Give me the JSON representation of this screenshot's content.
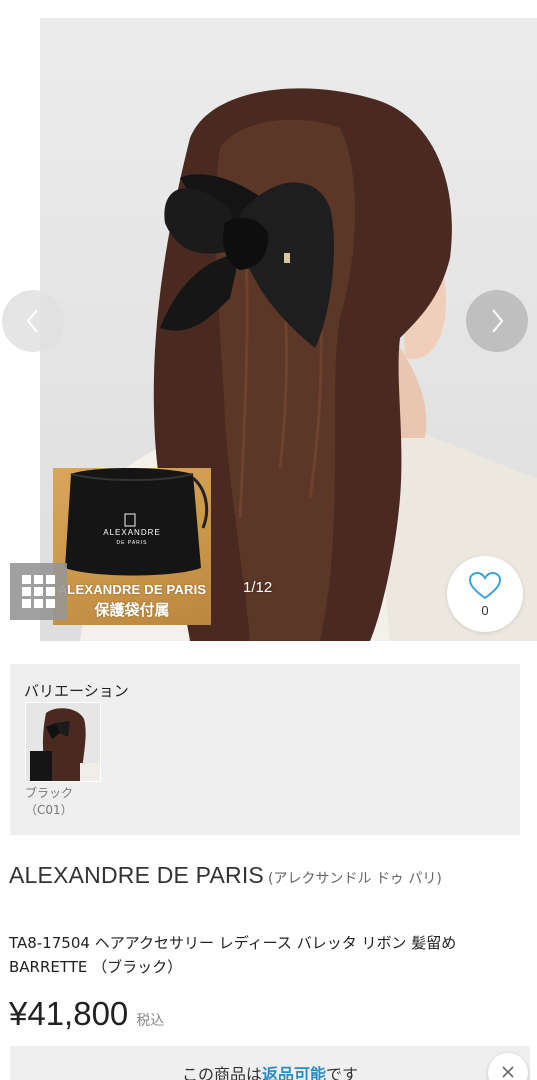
{
  "gallery": {
    "counter": "1/12",
    "promo": {
      "brand": "ALEXANDRE DE PARIS",
      "subtitle": "保護袋付属",
      "pouch_logo": "ALEXANDRE",
      "pouch_logo_sub": "DE PARIS"
    },
    "favorite_count": "0",
    "icons": {
      "prev": "chevron-left-icon",
      "next": "chevron-right-icon",
      "grid": "grid-icon",
      "favorite": "heart-icon"
    }
  },
  "variation": {
    "title": "バリエーション",
    "items": [
      {
        "label": "ブラック（C01）"
      }
    ]
  },
  "product": {
    "brand": "ALEXANDRE DE PARIS",
    "brand_kana": "(アレクサンドル ドゥ パリ)",
    "name": "TA8-17504 ヘアアクセサリー レディース バレッタ リボン 髪留め BARRETTE （ブラック）",
    "price": "¥41,800",
    "tax_label": "税込"
  },
  "banner": {
    "text_before": "この商品は",
    "highlight": "返品可能",
    "text_after": "です"
  },
  "colors": {
    "accent": "#2a8cc4",
    "panel_bg": "#efefef",
    "promo_gold": "#c99548"
  }
}
